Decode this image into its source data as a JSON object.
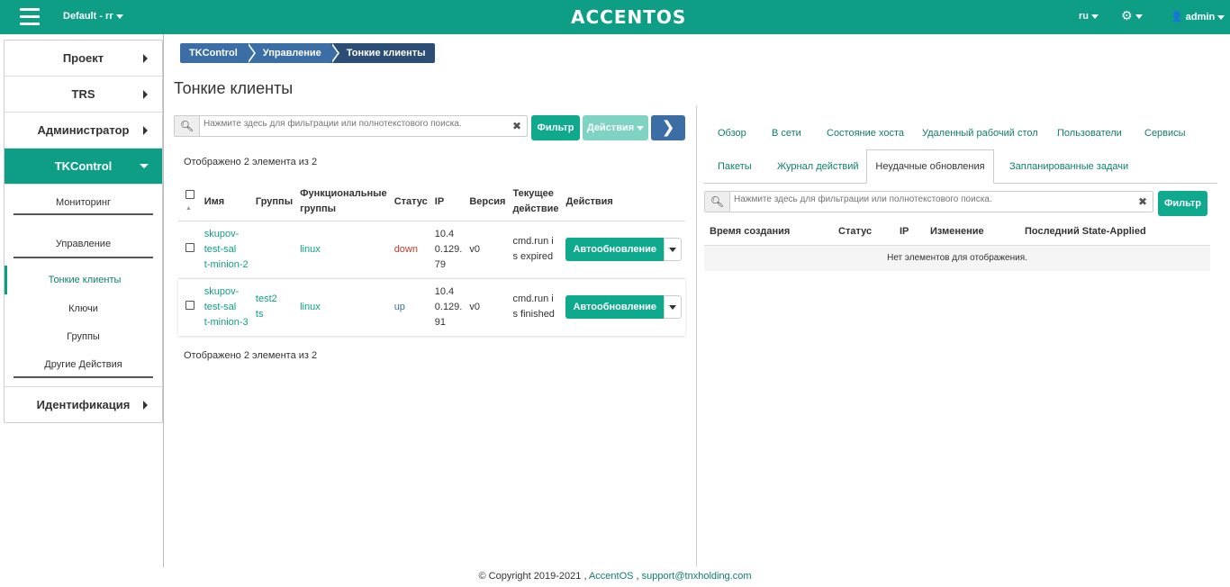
{
  "topbar": {
    "project": "Default - rr",
    "logo": "ACCENTOS",
    "lang": "ru",
    "user": "admin"
  },
  "sidebar": {
    "sections": [
      {
        "label": "Проект"
      },
      {
        "label": "TRS"
      },
      {
        "label": "Администратор"
      },
      {
        "label": "TKControl"
      },
      {
        "label": "Идентификация"
      }
    ],
    "sub": {
      "monitoring": "Мониторинг",
      "management": "Управление",
      "thin_clients": "Тонкие клиенты",
      "keys": "Ключи",
      "groups": "Группы",
      "other": "Другие Действия"
    }
  },
  "breadcrumb": [
    "TKControl",
    "Управление",
    "Тонкие клиенты"
  ],
  "page_title": "Тонкие клиенты",
  "left": {
    "search_placeholder": "Нажмите здесь для фильтрации или полнотекстового поиска.",
    "filter_btn": "Фильтр",
    "actions_btn": "Действия",
    "count_text": "Отображено 2 элемента из 2",
    "columns": {
      "name": "Имя",
      "groups": "Группы",
      "func1": "Функциональные",
      "func2": "группы",
      "status": "Статус",
      "ip": "IP",
      "version": "Версия",
      "action1": "Текущее",
      "action2": "действие",
      "actions": "Действия"
    },
    "rows": [
      {
        "name1": "skupov-test-sal",
        "name2": "t-minion-2",
        "groups1": "",
        "groups2": "",
        "func": "linux",
        "status": "down",
        "ip1": "10.4",
        "ip2": "0.129.",
        "ip3": "79",
        "version": "v0",
        "cur1": "cmd.run i",
        "cur2": "s expired",
        "btn": "Автообновление"
      },
      {
        "name1": "skupov-test-sal",
        "name2": "t-minion-3",
        "groups1": "test2",
        "groups2": "ts",
        "func": "linux",
        "status": "up",
        "ip1": "10.4",
        "ip2": "0.129.",
        "ip3": "91",
        "version": "v0",
        "cur1": "cmd.run i",
        "cur2": "s finished",
        "btn": "Автообновление"
      }
    ]
  },
  "right": {
    "tabs_row1": [
      "Обзор",
      "В сети",
      "Состояние хоста",
      "Удаленный рабочий стол",
      "Пользователи",
      "Сервисы"
    ],
    "tabs_row2": [
      "Пакеты",
      "Журнал действий",
      "Неудачные обновления",
      "Запланированные задачи"
    ],
    "search_placeholder": "Нажмите здесь для фильтрации или полнотекстового поиска.",
    "filter_btn": "Фильтр",
    "columns": [
      "Время создания",
      "Статус",
      "IP",
      "Изменение",
      "Последний State-Applied"
    ],
    "empty": "Нет элементов для отображения."
  },
  "footer": {
    "copyright": "© Copyright 2019-2021 ,",
    "brand": "AccentOS",
    "sep": ",",
    "email": "support@tnxholding.com"
  },
  "colors": {
    "primary": "#0e9e86",
    "blue": "#3b6ea5",
    "down": "#c0392b"
  }
}
